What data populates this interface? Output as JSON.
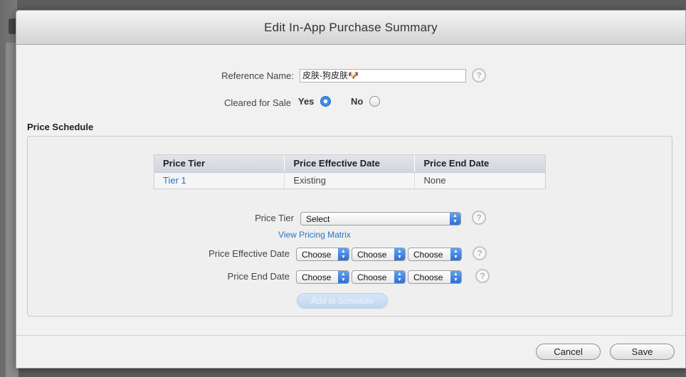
{
  "dialog": {
    "title": "Edit In-App Purchase Summary"
  },
  "reference": {
    "label": "Reference Name:",
    "value": "皮肤-狗皮肤🐶"
  },
  "cleared": {
    "label": "Cleared for Sale",
    "yes_label": "Yes",
    "no_label": "No",
    "selected": "Yes"
  },
  "price_schedule": {
    "heading": "Price Schedule",
    "columns": [
      "Price Tier",
      "Price Effective Date",
      "Price End Date"
    ],
    "rows": [
      [
        "Tier 1",
        "Existing",
        "None"
      ]
    ]
  },
  "form": {
    "price_tier_label": "Price Tier",
    "price_tier_value": "Select",
    "pricing_matrix_link": "View Pricing Matrix",
    "effective_date_label": "Price Effective Date",
    "end_date_label": "Price End Date",
    "choose": "Choose",
    "add_button": "Add to Schedule"
  },
  "footer": {
    "cancel": "Cancel",
    "save": "Save"
  },
  "help_glyph": "?",
  "icons": {
    "help": "question-circle-icon",
    "dropdown": "updown-chevron-icon"
  },
  "colors": {
    "accent": "#2a73c2",
    "radio_selected": "#3d8be8",
    "select_arrow": "#2e6fd4"
  }
}
